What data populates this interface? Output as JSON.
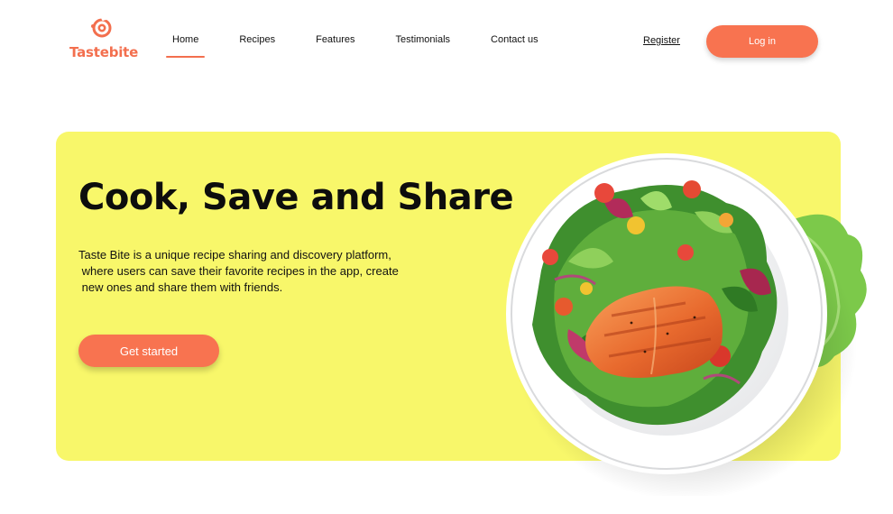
{
  "brand": {
    "name": "Tastebite",
    "color": "#f36f4e",
    "logo_icon": "swirl-logo-icon"
  },
  "nav": {
    "items": [
      {
        "label": "Home",
        "active": true
      },
      {
        "label": "Recipes",
        "active": false
      },
      {
        "label": "Features",
        "active": false
      },
      {
        "label": "Testimonials",
        "active": false
      },
      {
        "label": "Contact us",
        "active": false
      }
    ]
  },
  "auth": {
    "register_label": "Register",
    "login_label": "Log in"
  },
  "hero": {
    "title": "Cook, Save and Share",
    "description_lines": [
      "Taste Bite is a unique recipe sharing and discovery platform,",
      " where users can save their favorite recipes in the app, create",
      " new ones and share them with friends."
    ],
    "cta_label": "Get started",
    "background_color": "#f8f76a",
    "image": "salmon-salad-plate"
  },
  "accent_color": "#f87350"
}
